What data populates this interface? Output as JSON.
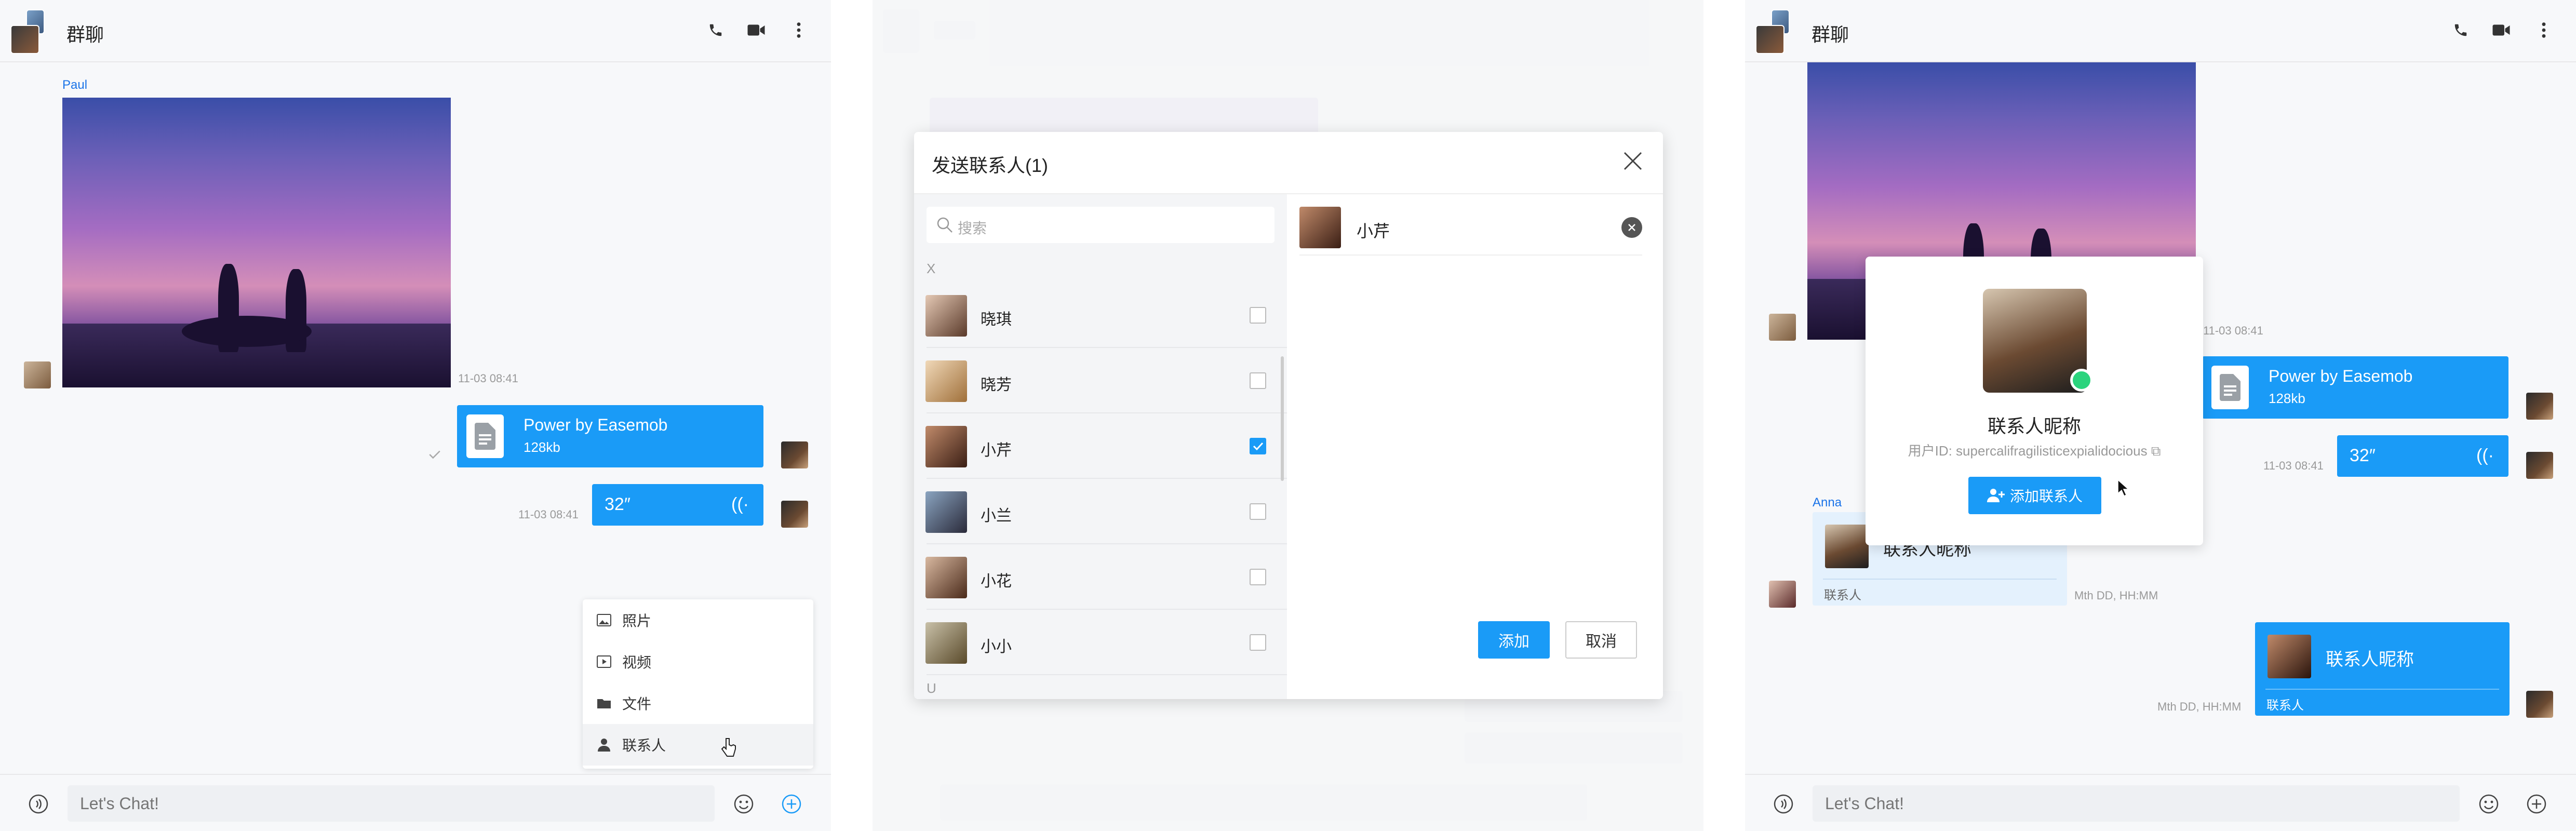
{
  "colors": {
    "accent": "#1a9bf7",
    "online": "#2bd47d",
    "sender": "#1a73e8"
  },
  "chat": {
    "title": "群聊",
    "input_placeholder": "Let's Chat!",
    "icons": {
      "call": "phone-icon",
      "video": "video-camera-icon",
      "more": "more-vertical-icon",
      "voice": "voice-icon",
      "emoji": "emoji-icon",
      "add": "plus-circle-icon"
    }
  },
  "panel1": {
    "sender_name": "Paul",
    "image_time": "11-03 08:41",
    "file": {
      "name": "Power by Easemob",
      "size": "128kb"
    },
    "voice": {
      "duration": "32″",
      "time": "11-03 08:41"
    },
    "menu": [
      {
        "label": "照片",
        "icon": "image-icon"
      },
      {
        "label": "视频",
        "icon": "video-icon"
      },
      {
        "label": "文件",
        "icon": "folder-icon"
      },
      {
        "label": "联系人",
        "icon": "person-icon"
      }
    ]
  },
  "modal": {
    "title": "发送联系人(1)",
    "search_placeholder": "搜索",
    "section_letters": [
      "X",
      "U"
    ],
    "contacts": [
      {
        "name": "晓琪",
        "checked": false
      },
      {
        "name": "晓芳",
        "checked": false
      },
      {
        "name": "小芹",
        "checked": true
      },
      {
        "name": "小兰",
        "checked": false
      },
      {
        "name": "小花",
        "checked": false
      },
      {
        "name": "小小",
        "checked": false
      }
    ],
    "selected": {
      "name": "小芹"
    },
    "add_label": "添加",
    "cancel_label": "取消"
  },
  "panel3": {
    "image_time": "11-03 08:41",
    "file": {
      "name": "Power by Easemob",
      "size": "128kb"
    },
    "voice": {
      "duration": "32″",
      "time": "11-03 08:41"
    },
    "card": {
      "nickname": "联系人昵称",
      "user_id": "用户ID: supercalifragilisticexpialidocious",
      "add_label": "添加联系人"
    },
    "anna": {
      "sender": "Anna",
      "name": "联系人昵称",
      "label": "联系人",
      "time": "Mth DD, HH:MM"
    },
    "mine": {
      "name": "联系人昵称",
      "label": "联系人",
      "time": "Mth DD, HH:MM"
    }
  }
}
